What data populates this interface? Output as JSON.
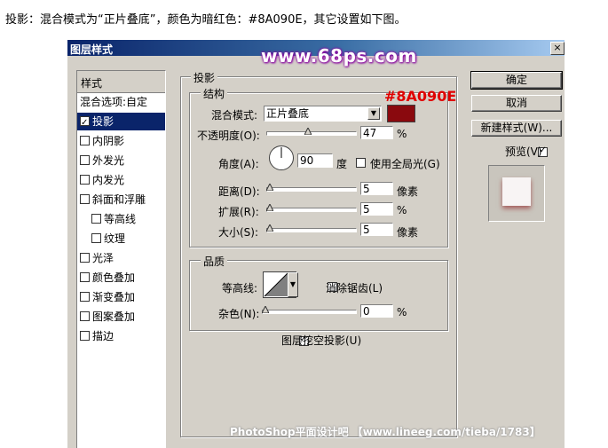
{
  "caption": "投影：混合模式为“正片叠底”，颜色为暗红色：#8A090E，其它设置如下图。",
  "dialog": {
    "title": "图层样式",
    "close": "×",
    "watermark": "www.68ps.com"
  },
  "left_panel": {
    "header": "样式",
    "items": [
      {
        "label": "混合选项:自定",
        "checkbox": false,
        "checked": false,
        "selected": false,
        "indent": false
      },
      {
        "label": "投影",
        "checkbox": true,
        "checked": true,
        "selected": true,
        "indent": false
      },
      {
        "label": "内阴影",
        "checkbox": true,
        "checked": false,
        "selected": false,
        "indent": false
      },
      {
        "label": "外发光",
        "checkbox": true,
        "checked": false,
        "selected": false,
        "indent": false
      },
      {
        "label": "内发光",
        "checkbox": true,
        "checked": false,
        "selected": false,
        "indent": false
      },
      {
        "label": "斜面和浮雕",
        "checkbox": true,
        "checked": false,
        "selected": false,
        "indent": false
      },
      {
        "label": "等高线",
        "checkbox": true,
        "checked": false,
        "selected": false,
        "indent": true
      },
      {
        "label": "纹理",
        "checkbox": true,
        "checked": false,
        "selected": false,
        "indent": true
      },
      {
        "label": "光泽",
        "checkbox": true,
        "checked": false,
        "selected": false,
        "indent": false
      },
      {
        "label": "颜色叠加",
        "checkbox": true,
        "checked": false,
        "selected": false,
        "indent": false
      },
      {
        "label": "渐变叠加",
        "checkbox": true,
        "checked": false,
        "selected": false,
        "indent": false
      },
      {
        "label": "图案叠加",
        "checkbox": true,
        "checked": false,
        "selected": false,
        "indent": false
      },
      {
        "label": "描边",
        "checkbox": true,
        "checked": false,
        "selected": false,
        "indent": false
      }
    ]
  },
  "drop_shadow": {
    "group_title": "投影",
    "structure": {
      "title": "结构",
      "blend_mode_label": "混合模式:",
      "blend_mode_value": "正片叠底",
      "color": "#8A090E",
      "color_annotation": "#8A090E",
      "opacity_label": "不透明度(O):",
      "opacity_value": "47",
      "opacity_fraction": 0.47,
      "percent": "%",
      "angle_label": "角度(A):",
      "angle_value": "90",
      "angle_unit": "度",
      "global_light_label": "使用全局光(G)",
      "global_light_checked": false,
      "distance_label": "距离(D):",
      "distance_value": "5",
      "px_unit": "像素",
      "spread_label": "扩展(R):",
      "spread_value": "5",
      "size_label": "大小(S):",
      "size_value": "5"
    },
    "quality": {
      "title": "品质",
      "contour_label": "等高线:",
      "anti_alias_label": "消除锯齿(L)",
      "anti_alias_checked": false,
      "noise_label": "杂色(N):",
      "noise_value": "0"
    },
    "knockout_label": "图层挖空投影(U)",
    "knockout_checked": true
  },
  "buttons": {
    "ok": "确定",
    "cancel": "取消",
    "new_style": "新建样式(W)..."
  },
  "preview": {
    "label": "预览(V)",
    "checked": true
  },
  "footer_watermark": "PhotoShop平面设计吧 【www.lineeg.com/tieba/1783】"
}
